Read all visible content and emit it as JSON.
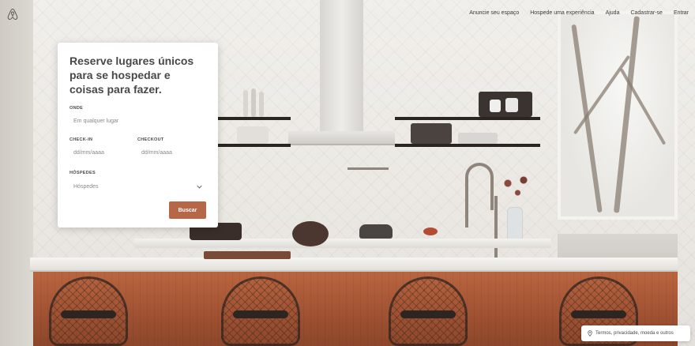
{
  "header": {
    "logo": "airbnb-logo-icon",
    "nav": [
      "Anuncie seu espaço",
      "Hospede uma experiência",
      "Ajuda",
      "Cadastrar-se",
      "Entrar"
    ]
  },
  "search_card": {
    "title": "Reserve lugares únicos para se hospedar e coisas para fazer.",
    "where_label": "ONDE",
    "where_placeholder": "Em qualquer lugar",
    "checkin_label": "CHECK-IN",
    "checkin_placeholder": "dd/mm/aaaa",
    "checkout_label": "CHECKOUT",
    "checkout_placeholder": "dd/mm/aaaa",
    "guests_label": "HÓSPEDES",
    "guests_value": "Hóspedes",
    "search_button": "Buscar"
  },
  "footer": {
    "text": "Termos, privacidade, moeda e outros",
    "icon": "location-pin-icon"
  },
  "colors": {
    "accent": "#b56747",
    "text": "#484848"
  }
}
